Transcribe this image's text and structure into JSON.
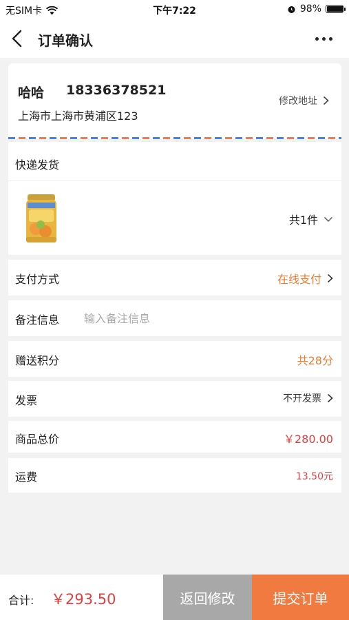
{
  "status_bar": {
    "carrier": "无SIM卡",
    "time": "下午7:22",
    "battery": "98%",
    "battery_level": 0.98
  },
  "nav": {
    "title": "订单确认"
  },
  "address": {
    "name": "哈哈",
    "phone": "18336378521",
    "detail": "上海市上海市黄浦区123",
    "edit_label": "修改地址"
  },
  "delivery": {
    "method": "快递发货",
    "count": "共1件"
  },
  "payment": {
    "label": "支付方式",
    "value": "在线支付"
  },
  "remark": {
    "label": "备注信息",
    "placeholder": "输入备注信息",
    "value": ""
  },
  "points": {
    "label": "赠送积分",
    "value": "共28分"
  },
  "invoice": {
    "label": "发票",
    "value": "不开发票"
  },
  "goods_total": {
    "label": "商品总价",
    "value": "￥280.00"
  },
  "freight": {
    "label": "运费",
    "value": "13.50元"
  },
  "footer": {
    "sum_label": "合计:",
    "sum_value": "￥293.50",
    "return_button": "返回修改",
    "submit_button": "提交订单"
  },
  "colors": {
    "accent_orange": "#f07a30",
    "price_red": "#e53d3d",
    "return_gray": "#a8a8a8",
    "submit_orange": "#f07a40"
  }
}
